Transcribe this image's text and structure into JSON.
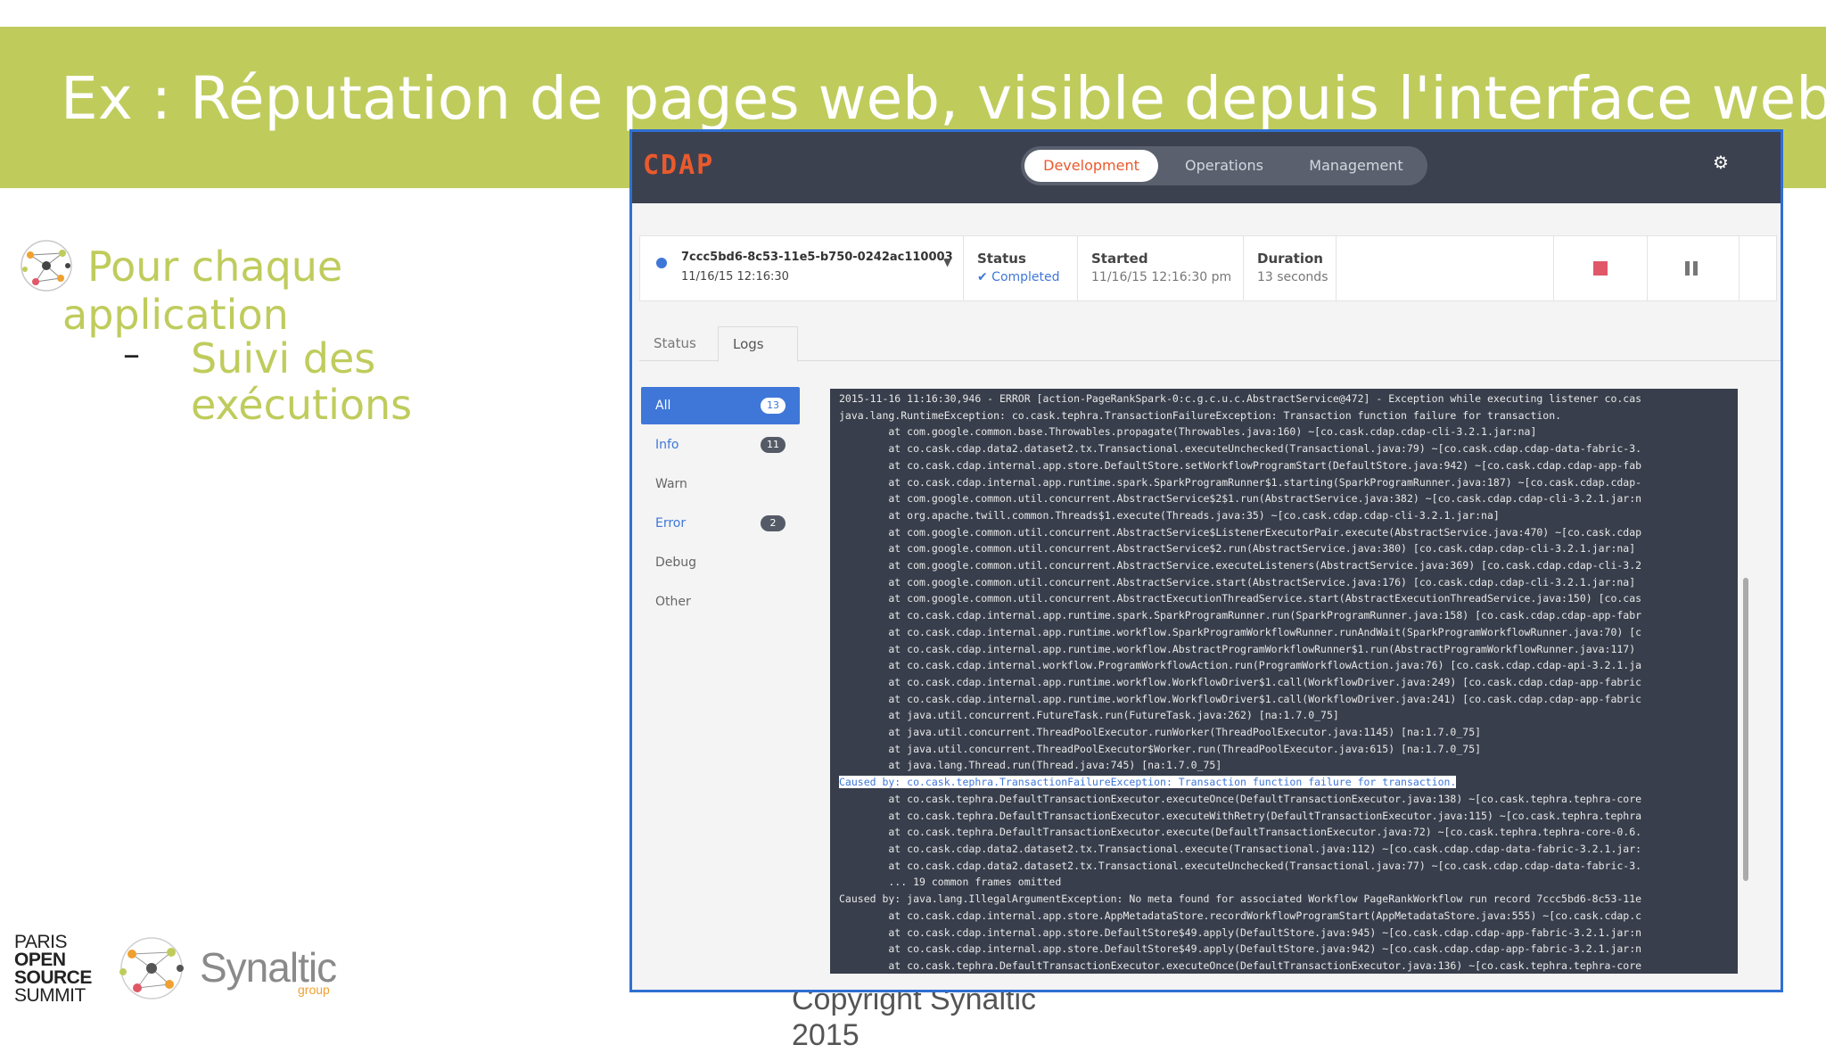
{
  "slide": {
    "title": "Ex : Réputation de pages web, visible depuis l'interface web",
    "bullet_line1": "Pour chaque",
    "bullet_line2": "application",
    "dash": "–",
    "sub_line1": "Suivi des",
    "sub_line2": "exécutions",
    "paris_logo": [
      "PARIS",
      "OPEN",
      "SOURCE",
      "SUMMIT"
    ],
    "synaltic_name": "Synaltic",
    "synaltic_group": "group",
    "copyright_line1": "Copyright Synaltic",
    "copyright_line2": "2015"
  },
  "app": {
    "logo": "CDAP",
    "nav": {
      "development": "Development",
      "operations": "Operations",
      "management": "Management"
    },
    "gear_icon": "⚙",
    "run": {
      "id": "7ccc5bd6-8c53-11e5-b750-0242ac110003",
      "time": "11/16/15 12:16:30",
      "status_label": "Status",
      "status_value": "✔ Completed",
      "started_label": "Started",
      "started_value": "11/16/15 12:16:30 pm",
      "duration_label": "Duration",
      "duration_value": "13 seconds"
    },
    "tabs": {
      "status": "Status",
      "logs": "Logs"
    },
    "filters": [
      {
        "label": "All",
        "count": "13"
      },
      {
        "label": "Info",
        "count": "11"
      },
      {
        "label": "Warn",
        "count": ""
      },
      {
        "label": "Error",
        "count": "2"
      },
      {
        "label": "Debug",
        "count": ""
      },
      {
        "label": "Other",
        "count": ""
      }
    ],
    "log_lines": [
      "2015-11-16 11:16:30,946 - ERROR [action-PageRankSpark-0:c.g.c.u.c.AbstractService@472] - Exception while executing listener co.cas",
      "java.lang.RuntimeException: co.cask.tephra.TransactionFailureException: Transaction function failure for transaction.",
      "        at com.google.common.base.Throwables.propagate(Throwables.java:160) ~[co.cask.cdap.cdap-cli-3.2.1.jar:na]",
      "        at co.cask.cdap.data2.dataset2.tx.Transactional.executeUnchecked(Transactional.java:79) ~[co.cask.cdap.cdap-data-fabric-3.",
      "        at co.cask.cdap.internal.app.store.DefaultStore.setWorkflowProgramStart(DefaultStore.java:942) ~[co.cask.cdap.cdap-app-fab",
      "        at co.cask.cdap.internal.app.runtime.spark.SparkProgramRunner$1.starting(SparkProgramRunner.java:187) ~[co.cask.cdap.cdap-",
      "        at com.google.common.util.concurrent.AbstractService$2$1.run(AbstractService.java:382) ~[co.cask.cdap.cdap-cli-3.2.1.jar:n",
      "        at org.apache.twill.common.Threads$1.execute(Threads.java:35) ~[co.cask.cdap.cdap-cli-3.2.1.jar:na]",
      "        at com.google.common.util.concurrent.AbstractService$ListenerExecutorPair.execute(AbstractService.java:470) ~[co.cask.cdap",
      "        at com.google.common.util.concurrent.AbstractService$2.run(AbstractService.java:380) [co.cask.cdap.cdap-cli-3.2.1.jar:na]",
      "        at com.google.common.util.concurrent.AbstractService.executeListeners(AbstractService.java:369) [co.cask.cdap.cdap-cli-3.2",
      "        at com.google.common.util.concurrent.AbstractService.start(AbstractService.java:176) [co.cask.cdap.cdap-cli-3.2.1.jar:na]",
      "        at com.google.common.util.concurrent.AbstractExecutionThreadService.start(AbstractExecutionThreadService.java:150) [co.cas",
      "        at co.cask.cdap.internal.app.runtime.spark.SparkProgramRunner.run(SparkProgramRunner.java:158) [co.cask.cdap.cdap-app-fabr",
      "        at co.cask.cdap.internal.app.runtime.workflow.SparkProgramWorkflowRunner.runAndWait(SparkProgramWorkflowRunner.java:70) [c",
      "        at co.cask.cdap.internal.app.runtime.workflow.AbstractProgramWorkflowRunner$1.run(AbstractProgramWorkflowRunner.java:117)",
      "        at co.cask.cdap.internal.workflow.ProgramWorkflowAction.run(ProgramWorkflowAction.java:76) [co.cask.cdap.cdap-api-3.2.1.ja",
      "        at co.cask.cdap.internal.app.runtime.workflow.WorkflowDriver$1.call(WorkflowDriver.java:249) [co.cask.cdap.cdap-app-fabric",
      "        at co.cask.cdap.internal.app.runtime.workflow.WorkflowDriver$1.call(WorkflowDriver.java:241) [co.cask.cdap.cdap-app-fabric",
      "        at java.util.concurrent.FutureTask.run(FutureTask.java:262) [na:1.7.0_75]",
      "        at java.util.concurrent.ThreadPoolExecutor.runWorker(ThreadPoolExecutor.java:1145) [na:1.7.0_75]",
      "        at java.util.concurrent.ThreadPoolExecutor$Worker.run(ThreadPoolExecutor.java:615) [na:1.7.0_75]",
      "        at java.lang.Thread.run(Thread.java:745) [na:1.7.0_75]",
      "Caused by: co.cask.tephra.TransactionFailureException: Transaction function failure for transaction.",
      "        at co.cask.tephra.DefaultTransactionExecutor.executeOnce(DefaultTransactionExecutor.java:138) ~[co.cask.tephra.tephra-core",
      "        at co.cask.tephra.DefaultTransactionExecutor.executeWithRetry(DefaultTransactionExecutor.java:115) ~[co.cask.tephra.tephra",
      "        at co.cask.tephra.DefaultTransactionExecutor.execute(DefaultTransactionExecutor.java:72) ~[co.cask.tephra.tephra-core-0.6.",
      "        at co.cask.cdap.data2.dataset2.tx.Transactional.execute(Transactional.java:112) ~[co.cask.cdap.cdap-data-fabric-3.2.1.jar:",
      "        at co.cask.cdap.data2.dataset2.tx.Transactional.executeUnchecked(Transactional.java:77) ~[co.cask.cdap.cdap-data-fabric-3.",
      "        ... 19 common frames omitted",
      "Caused by: java.lang.IllegalArgumentException: No meta found for associated Workflow PageRankWorkflow run record 7ccc5bd6-8c53-11e",
      "        at co.cask.cdap.internal.app.store.AppMetadataStore.recordWorkflowProgramStart(AppMetadataStore.java:555) ~[co.cask.cdap.c",
      "        at co.cask.cdap.internal.app.store.DefaultStore$49.apply(DefaultStore.java:945) ~[co.cask.cdap.cdap-app-fabric-3.2.1.jar:n",
      "        at co.cask.cdap.internal.app.store.DefaultStore$49.apply(DefaultStore.java:942) ~[co.cask.cdap.cdap-app-fabric-3.2.1.jar:n",
      "        at co.cask.tephra.DefaultTransactionExecutor.executeOnce(DefaultTransactionExecutor.java:136) ~[co.cask.tephra.tephra-core"
    ],
    "highlighted_line": 23
  }
}
